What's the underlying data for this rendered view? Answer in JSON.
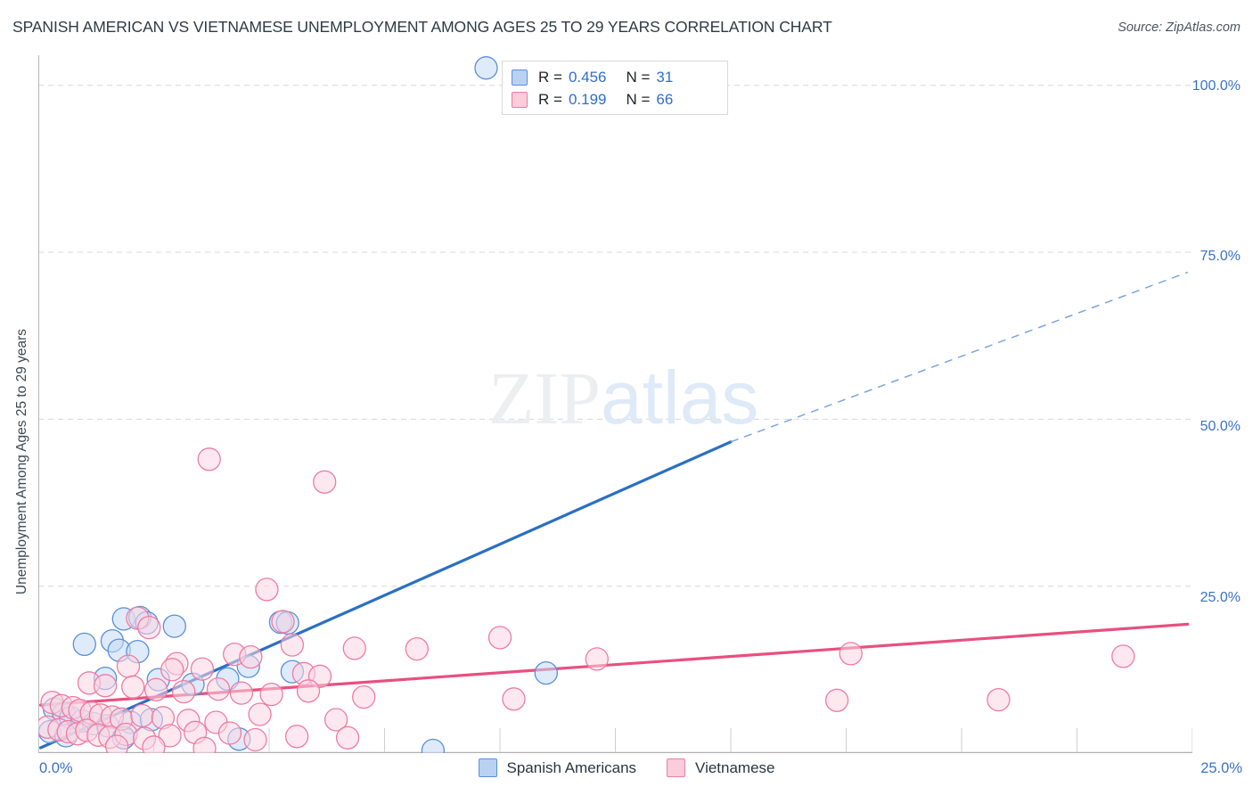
{
  "header": {
    "title": "SPANISH AMERICAN VS VIETNAMESE UNEMPLOYMENT AMONG AGES 25 TO 29 YEARS CORRELATION CHART",
    "source": "Source: ZipAtlas.com"
  },
  "watermark": {
    "part1": "ZIP",
    "part2": "atlas"
  },
  "stats_legend": {
    "rows": [
      {
        "r_label": "R =",
        "r_value": "0.456",
        "n_label": "N =",
        "n_value": "31",
        "color": "#5a8fd8"
      },
      {
        "r_label": "R =",
        "r_value": "0.199",
        "n_label": "N =",
        "n_value": "66",
        "color": "#ee7ca2"
      }
    ]
  },
  "series_legend": [
    {
      "label": "Spanish Americans",
      "color": "#b9d2f2"
    },
    {
      "label": "Vietnamese",
      "color": "#fcccdb"
    }
  ],
  "axes": {
    "y_title": "Unemployment Among Ages 25 to 29 years",
    "y_ticks": [
      "100.0%",
      "75.0%",
      "50.0%",
      "25.0%"
    ],
    "x_min_label": "0.0%",
    "x_max_label": "25.0%"
  },
  "chart_data": {
    "type": "scatter",
    "title": "SPANISH AMERICAN VS VIETNAMESE UNEMPLOYMENT AMONG AGES 25 TO 29 YEARS CORRELATION CHART",
    "xlabel": "",
    "ylabel": "Unemployment Among Ages 25 to 29 years",
    "xlim": [
      0,
      25
    ],
    "ylim": [
      0,
      104.5
    ],
    "x_unit": "%",
    "y_unit": "%",
    "grid": "horizontal-dashed",
    "legend_position": "bottom-center",
    "y_tick_values": [
      25,
      50,
      75,
      100
    ],
    "x_tick_values": [
      0,
      2.5,
      5,
      7.5,
      10,
      12.5,
      15,
      17.5,
      20,
      22.5,
      25
    ],
    "series": [
      {
        "name": "Spanish Americans",
        "r": 0.456,
        "n": 31,
        "fill": "#c5daf5",
        "stroke": "#5a8fd8",
        "trend": {
          "solid": {
            "x0": 0.05,
            "y0": 0.8,
            "x1": 15.0,
            "y1": 46.6
          },
          "dashed": {
            "x0": 15.0,
            "y0": 46.6,
            "x1": 24.9,
            "y1": 72.0
          }
        },
        "points": [
          {
            "x": 9.7,
            "y": 102.6
          },
          {
            "x": 1.85,
            "y": 20.1
          },
          {
            "x": 2.2,
            "y": 20.3
          },
          {
            "x": 2.35,
            "y": 19.5
          },
          {
            "x": 2.95,
            "y": 19.0
          },
          {
            "x": 5.25,
            "y": 19.6
          },
          {
            "x": 5.4,
            "y": 19.5
          },
          {
            "x": 1.0,
            "y": 16.3
          },
          {
            "x": 1.6,
            "y": 16.8
          },
          {
            "x": 1.75,
            "y": 15.4
          },
          {
            "x": 2.15,
            "y": 15.2
          },
          {
            "x": 4.55,
            "y": 13.0
          },
          {
            "x": 5.5,
            "y": 12.2
          },
          {
            "x": 1.45,
            "y": 11.2
          },
          {
            "x": 2.6,
            "y": 11.0
          },
          {
            "x": 3.35,
            "y": 10.3
          },
          {
            "x": 4.1,
            "y": 11.1
          },
          {
            "x": 11.0,
            "y": 12.0
          },
          {
            "x": 0.35,
            "y": 6.6
          },
          {
            "x": 0.55,
            "y": 5.9
          },
          {
            "x": 0.7,
            "y": 5.3
          },
          {
            "x": 0.95,
            "y": 4.8
          },
          {
            "x": 1.2,
            "y": 4.4
          },
          {
            "x": 1.5,
            "y": 4.1
          },
          {
            "x": 2.0,
            "y": 4.6
          },
          {
            "x": 2.45,
            "y": 5.0
          },
          {
            "x": 0.25,
            "y": 3.2
          },
          {
            "x": 0.6,
            "y": 2.6
          },
          {
            "x": 1.85,
            "y": 2.3
          },
          {
            "x": 4.35,
            "y": 2.1
          },
          {
            "x": 8.55,
            "y": 0.4
          }
        ]
      },
      {
        "name": "Vietnamese",
        "r": 0.199,
        "n": 66,
        "fill": "#fcd6e1",
        "stroke": "#ee7ca2",
        "trend": {
          "solid": {
            "x0": 0.05,
            "y0": 7.2,
            "x1": 24.9,
            "y1": 19.3
          }
        },
        "points": [
          {
            "x": 3.7,
            "y": 44.0
          },
          {
            "x": 6.2,
            "y": 40.6
          },
          {
            "x": 4.95,
            "y": 24.5
          },
          {
            "x": 5.3,
            "y": 19.7
          },
          {
            "x": 2.15,
            "y": 20.2
          },
          {
            "x": 2.4,
            "y": 18.8
          },
          {
            "x": 10.0,
            "y": 17.3
          },
          {
            "x": 5.5,
            "y": 16.2
          },
          {
            "x": 6.85,
            "y": 15.7
          },
          {
            "x": 8.2,
            "y": 15.6
          },
          {
            "x": 17.6,
            "y": 14.9
          },
          {
            "x": 12.1,
            "y": 14.1
          },
          {
            "x": 4.25,
            "y": 14.8
          },
          {
            "x": 4.6,
            "y": 14.4
          },
          {
            "x": 1.95,
            "y": 13.0
          },
          {
            "x": 3.0,
            "y": 13.4
          },
          {
            "x": 2.9,
            "y": 12.5
          },
          {
            "x": 3.55,
            "y": 12.6
          },
          {
            "x": 5.75,
            "y": 11.9
          },
          {
            "x": 6.1,
            "y": 11.5
          },
          {
            "x": 23.5,
            "y": 14.5
          },
          {
            "x": 1.1,
            "y": 10.5
          },
          {
            "x": 1.45,
            "y": 10.1
          },
          {
            "x": 2.05,
            "y": 9.9
          },
          {
            "x": 2.55,
            "y": 9.5
          },
          {
            "x": 3.15,
            "y": 9.2
          },
          {
            "x": 3.9,
            "y": 9.6
          },
          {
            "x": 4.4,
            "y": 9.0
          },
          {
            "x": 5.05,
            "y": 8.8
          },
          {
            "x": 5.85,
            "y": 9.3
          },
          {
            "x": 7.05,
            "y": 8.4
          },
          {
            "x": 10.3,
            "y": 8.1
          },
          {
            "x": 0.3,
            "y": 7.6
          },
          {
            "x": 0.5,
            "y": 7.1
          },
          {
            "x": 0.75,
            "y": 6.8
          },
          {
            "x": 0.9,
            "y": 6.4
          },
          {
            "x": 1.15,
            "y": 6.0
          },
          {
            "x": 1.35,
            "y": 5.7
          },
          {
            "x": 1.6,
            "y": 5.4
          },
          {
            "x": 1.8,
            "y": 5.1
          },
          {
            "x": 2.25,
            "y": 5.6
          },
          {
            "x": 2.7,
            "y": 5.3
          },
          {
            "x": 3.25,
            "y": 4.9
          },
          {
            "x": 3.85,
            "y": 4.6
          },
          {
            "x": 4.8,
            "y": 5.8
          },
          {
            "x": 6.45,
            "y": 5.0
          },
          {
            "x": 0.2,
            "y": 3.9
          },
          {
            "x": 0.45,
            "y": 3.5
          },
          {
            "x": 0.65,
            "y": 3.2
          },
          {
            "x": 0.85,
            "y": 2.9
          },
          {
            "x": 1.05,
            "y": 3.4
          },
          {
            "x": 1.3,
            "y": 2.7
          },
          {
            "x": 1.55,
            "y": 2.4
          },
          {
            "x": 1.9,
            "y": 2.8
          },
          {
            "x": 2.3,
            "y": 2.2
          },
          {
            "x": 2.85,
            "y": 2.6
          },
          {
            "x": 3.4,
            "y": 3.1
          },
          {
            "x": 4.15,
            "y": 3.0
          },
          {
            "x": 4.7,
            "y": 2.0
          },
          {
            "x": 5.6,
            "y": 2.5
          },
          {
            "x": 6.7,
            "y": 2.3
          },
          {
            "x": 1.7,
            "y": 1.0
          },
          {
            "x": 2.5,
            "y": 0.9
          },
          {
            "x": 3.6,
            "y": 0.7
          },
          {
            "x": 17.3,
            "y": 7.9
          },
          {
            "x": 20.8,
            "y": 8.0
          }
        ]
      }
    ]
  }
}
